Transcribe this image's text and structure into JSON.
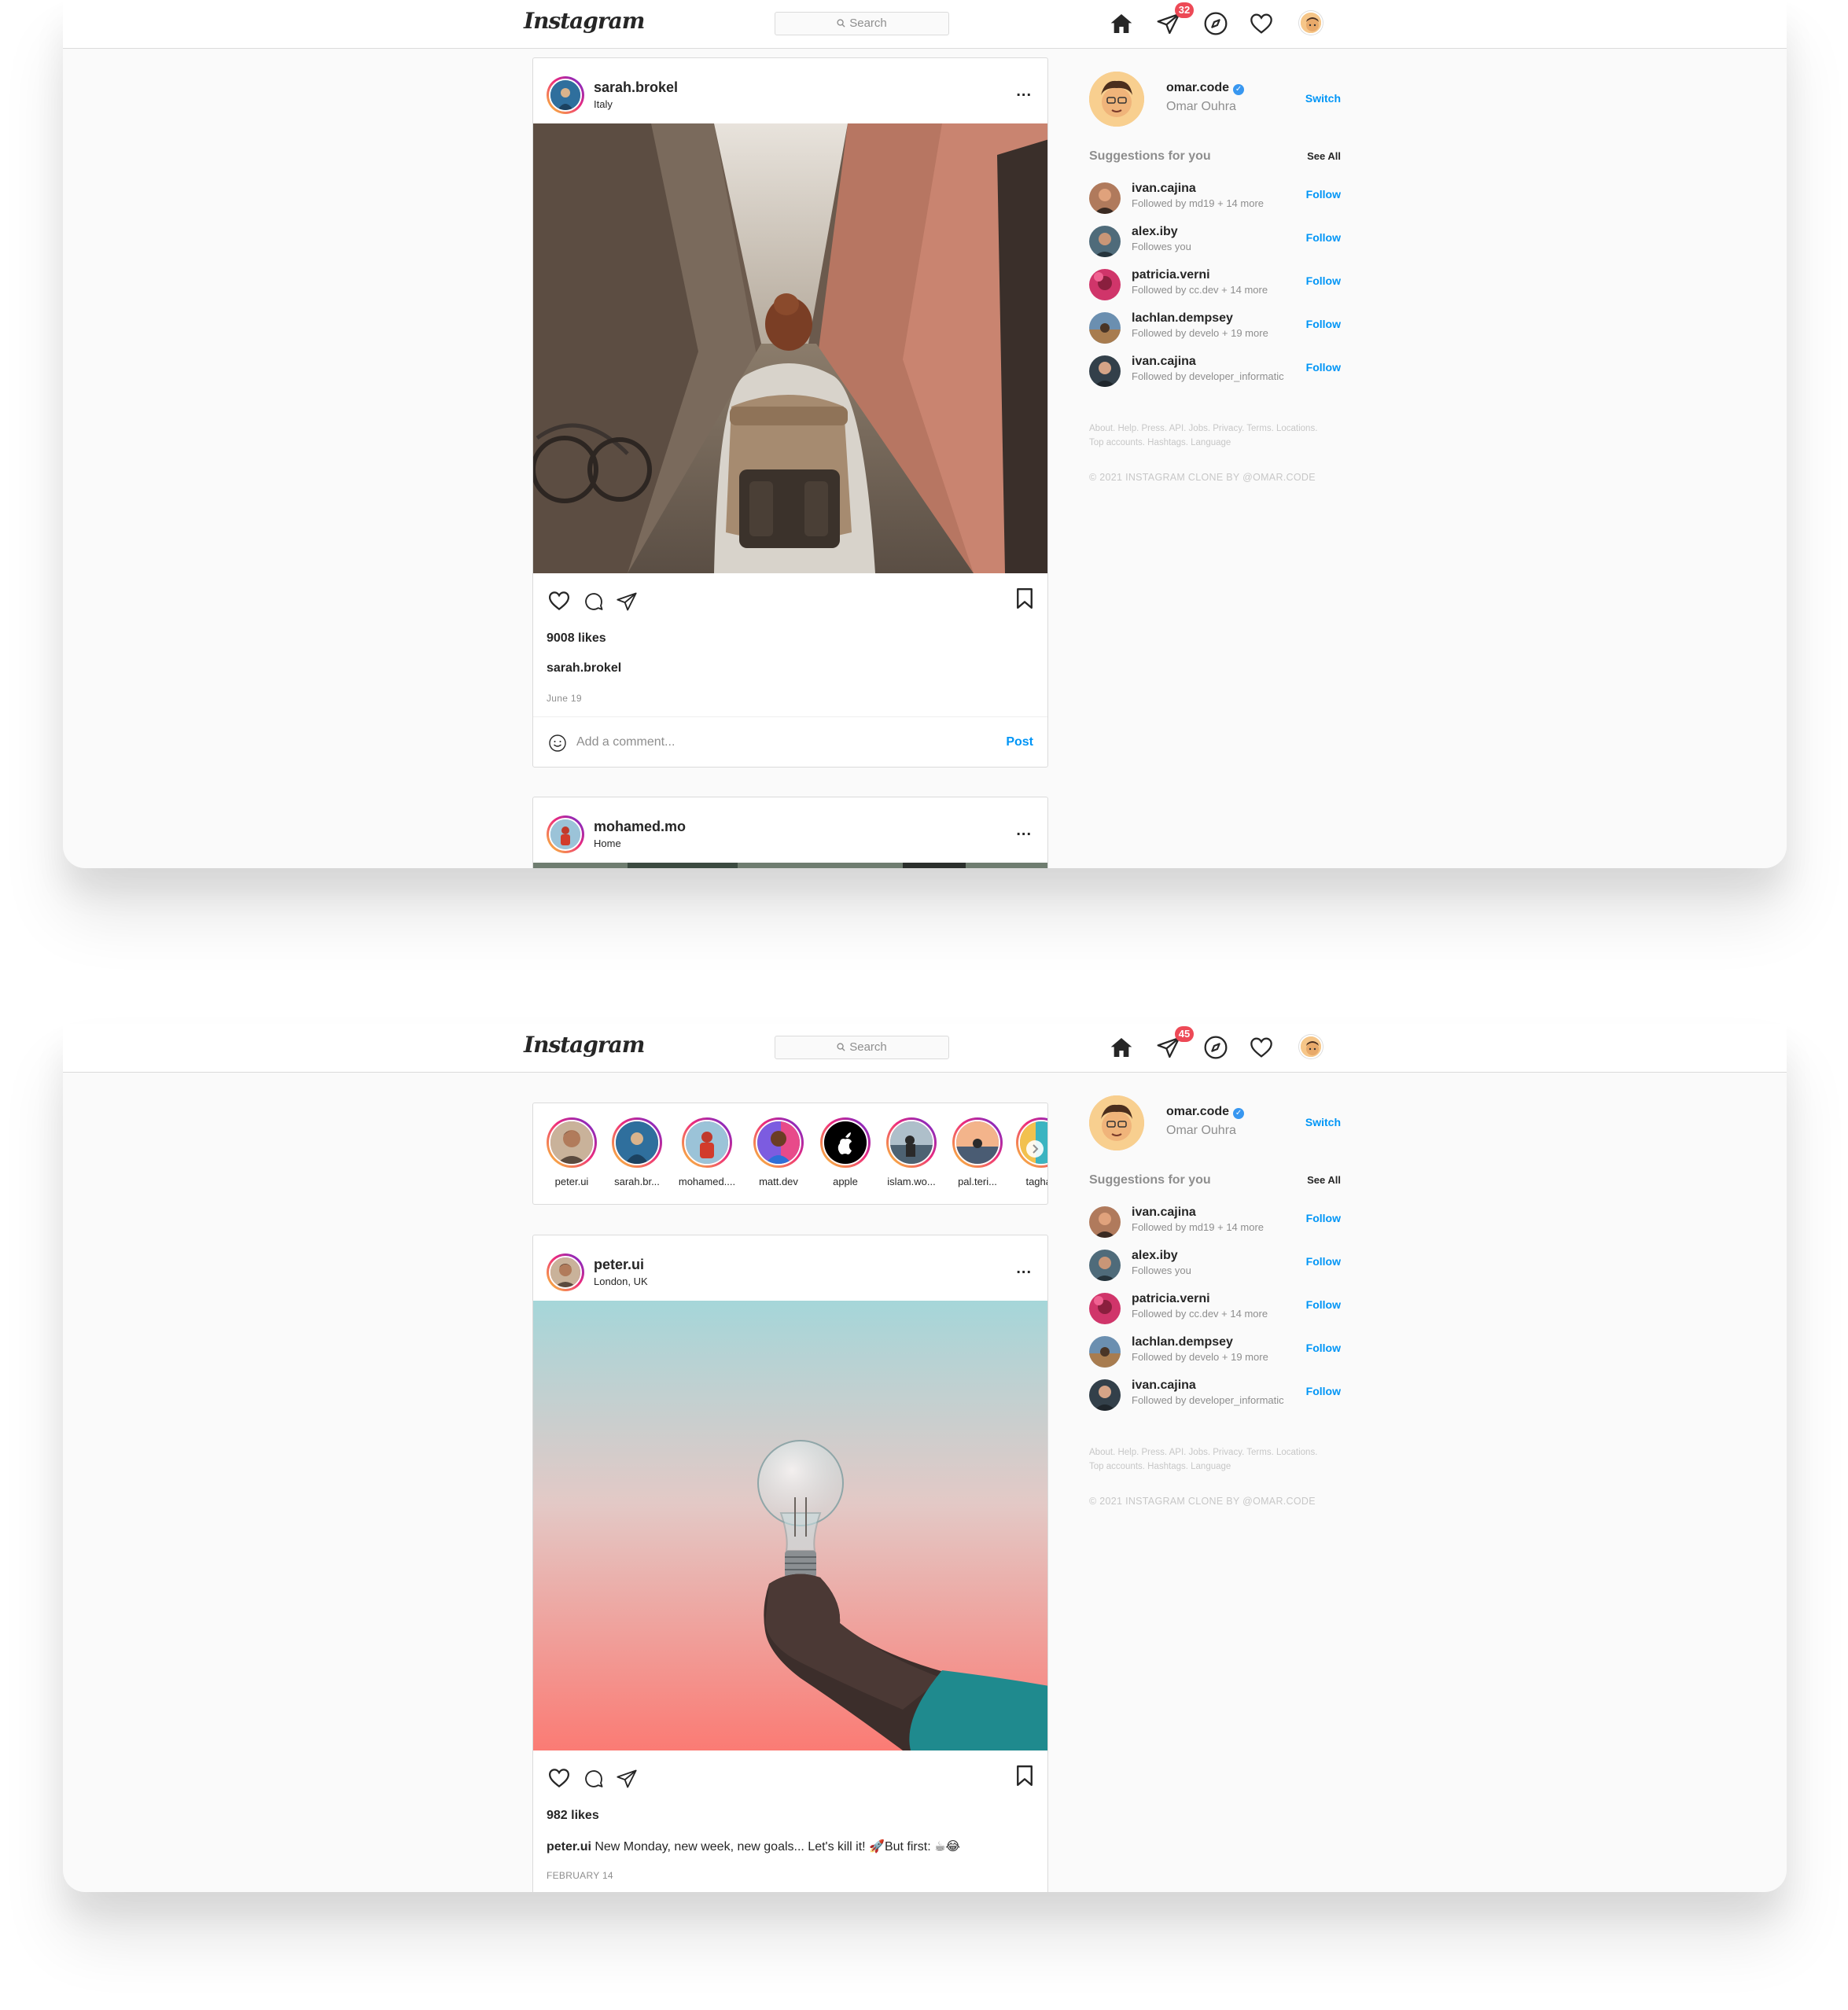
{
  "nav": {
    "logo": "Instagram",
    "search_placeholder": "Search",
    "screens": [
      {
        "dm_count": "32"
      },
      {
        "dm_count": "45"
      }
    ]
  },
  "me": {
    "username": "omar.code",
    "name": "Omar Ouhra",
    "switch": "Switch"
  },
  "suggestions": {
    "title": "Suggestions for you",
    "see_all": "See All",
    "follow": "Follow",
    "items": [
      {
        "username": "ivan.cajina",
        "sub": "Followed by md19 + 14 more"
      },
      {
        "username": "alex.iby",
        "sub": "Followes you"
      },
      {
        "username": "patricia.verni",
        "sub": "Followed by cc.dev + 14 more"
      },
      {
        "username": "lachlan.dempsey",
        "sub": "Followed by develo + 19 more"
      },
      {
        "username": "ivan.cajina",
        "sub": "Followed by developer_informatic"
      }
    ]
  },
  "footer": {
    "links": "About. Help. Press. API. Jobs. Privacy. Terms. Locations. Top accounts. Hashtags. Language",
    "copyright": "© 2021 INSTAGRAM CLONE BY @OMAR.CODE"
  },
  "post1": {
    "username": "sarah.brokel",
    "location": "Italy",
    "likes": "9008 likes",
    "caption_user": "sarah.brokel",
    "caption_text": "",
    "date": "June 19",
    "comment_placeholder": "Add a comment...",
    "post_btn": "Post"
  },
  "post2": {
    "username": "mohamed.mo",
    "location": "Home"
  },
  "stories": [
    "peter.ui",
    "sarah.br...",
    "mohamed....",
    "matt.dev",
    "apple",
    "islam.wo...",
    "pal.teri...",
    "taghaz"
  ],
  "post3": {
    "username": "peter.ui",
    "location": "London, UK",
    "likes": "982 likes",
    "caption_user": "peter.ui",
    "caption_text": " New Monday, new week, new goals... Let's kill it! 🚀But first: ☕😂",
    "date": "FEBRUARY 14"
  },
  "colors": {
    "accent": "#0095f6",
    "badge": "#ed4956",
    "border": "#dbdbdb"
  }
}
